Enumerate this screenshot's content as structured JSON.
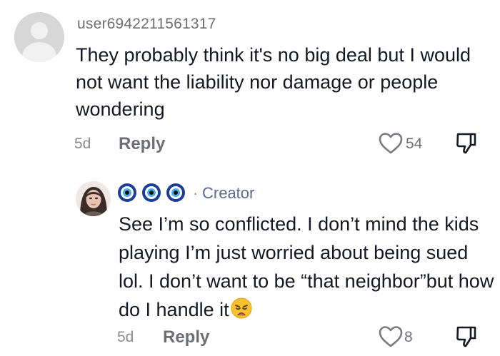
{
  "comment1": {
    "username": "user6942211561317",
    "text": "They probably think it's no big deal but I would not want the liability nor damage or people wondering",
    "date": "5d",
    "reply_label": "Reply",
    "like_count": "54",
    "icons": {
      "avatar": "default-avatar-icon",
      "like": "heart-outline-icon",
      "dislike": "thumbs-down-icon"
    }
  },
  "comment2": {
    "badge": "Creator",
    "separator": "·",
    "text": "See I’m so conflicted. I don’t mind the kids playing I’m just worried about being sued lol. I don’t want to be “that neighbor”but how do I handle it",
    "date": "5d",
    "reply_label": "Reply",
    "like_count": "8",
    "icons": {
      "name_emojis": [
        "nazar-amulet-icon",
        "nazar-amulet-icon",
        "nazar-amulet-icon"
      ],
      "trailing_emoji": "weary-face-emoji",
      "like": "heart-outline-icon",
      "dislike": "thumbs-down-icon"
    }
  },
  "colors": {
    "text": "#161823",
    "secondary": "#6e6f75",
    "creator": "#5a6b8c",
    "background": "#ffffff"
  }
}
